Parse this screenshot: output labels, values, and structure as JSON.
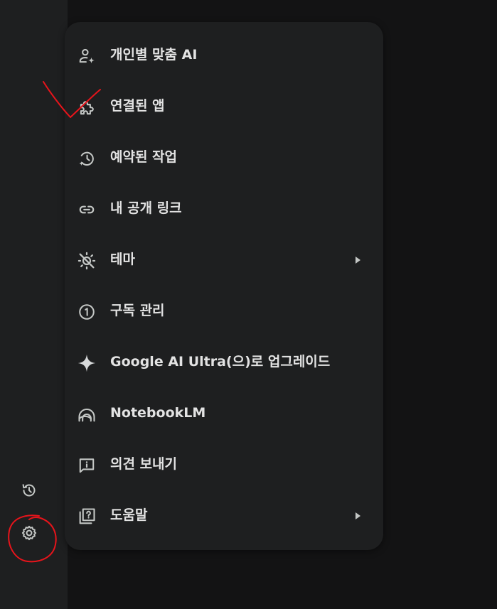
{
  "menu": {
    "items": [
      {
        "label": "개인별 맞춤 AI",
        "icon": "personalization-sparkle-icon"
      },
      {
        "label": "연결된 앱",
        "icon": "puzzle-extension-icon"
      },
      {
        "label": "예약된 작업",
        "icon": "scheduled-history-icon"
      },
      {
        "label": "내 공개 링크",
        "icon": "link-icon"
      },
      {
        "label": "테마",
        "icon": "theme-sun-icon",
        "has_submenu": true
      },
      {
        "label": "구독 관리",
        "icon": "subscription-one-icon"
      },
      {
        "label": "Google AI Ultra(으)로 업그레이드",
        "icon": "sparkle-icon"
      },
      {
        "label": "NotebookLM",
        "icon": "notebooklm-icon"
      },
      {
        "label": "의견 보내기",
        "icon": "feedback-icon"
      },
      {
        "label": "도움말",
        "icon": "help-icon",
        "has_submenu": true
      }
    ]
  },
  "rail": {
    "items": [
      {
        "icon": "activity-history-icon"
      },
      {
        "icon": "settings-gear-icon"
      }
    ]
  },
  "colors": {
    "background": "#131314",
    "surface": "#1e1f20",
    "text": "#e3e3e3",
    "icon": "#c4c7c5",
    "annotation": "#e8141b"
  }
}
